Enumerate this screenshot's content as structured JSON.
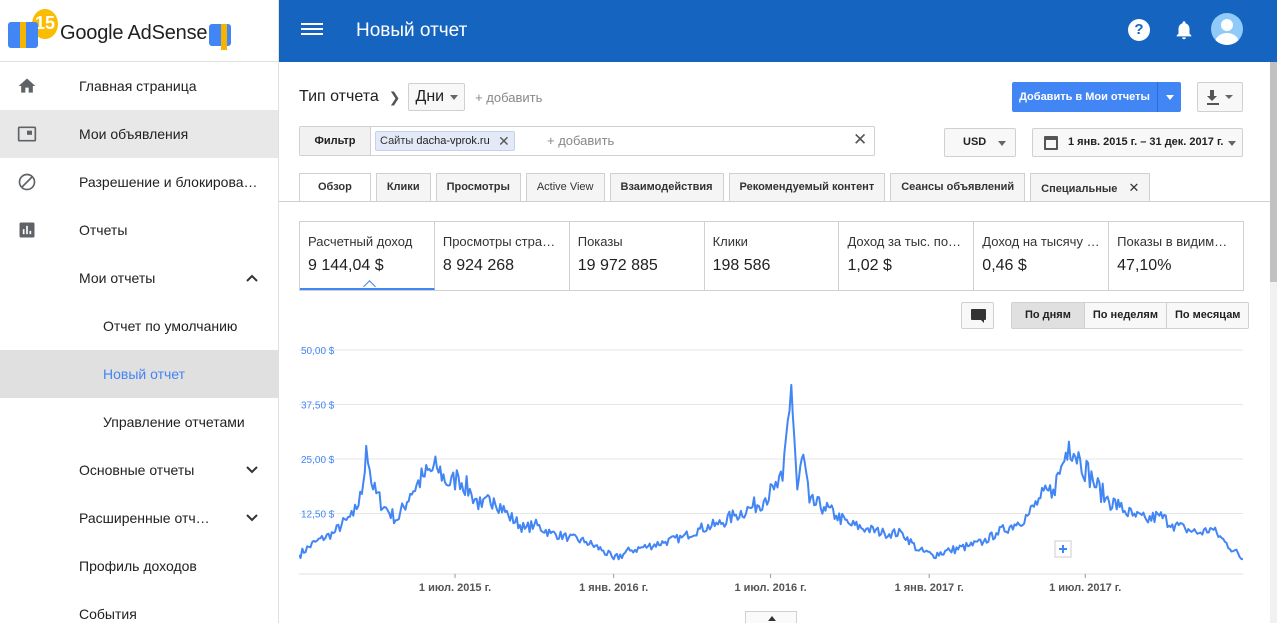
{
  "logo": {
    "badge": "15",
    "brand": "Google AdSense"
  },
  "topbar": {
    "title": "Новый отчет",
    "help": "?"
  },
  "sidebar": {
    "items": [
      {
        "label": "Главная страница",
        "icon": "home-icon"
      },
      {
        "label": "Мои объявления",
        "icon": "ad-unit-icon"
      },
      {
        "label": "Разрешение и блокирова…",
        "icon": "block-icon"
      },
      {
        "label": "Отчеты",
        "icon": "bar-chart-icon"
      },
      {
        "label": "Мои отчеты"
      },
      {
        "label": "Отчет по умолчанию"
      },
      {
        "label": "Новый отчет"
      },
      {
        "label": "Управление отчетами"
      },
      {
        "label": "Основные отчеты"
      },
      {
        "label": "Расширенные отч…"
      },
      {
        "label": "Профиль доходов"
      },
      {
        "label": "События"
      }
    ]
  },
  "report": {
    "type_label": "Тип отчета",
    "dimension": "Дни",
    "add_label": "+ добавить"
  },
  "toolbar": {
    "add_to_reports": "Добавить в Мои отчеты"
  },
  "filter": {
    "label": "Фильтр",
    "chip_prefix": "Сайты",
    "chip_value": "dacha-vprok.ru",
    "add_label": "+ добавить",
    "remove": "✕",
    "clear": "✕"
  },
  "currency": "USD",
  "date_range": "1 янв. 2015 г. – 31 дек. 2017 г.",
  "tabs": [
    "Обзор",
    "Клики",
    "Просмотры",
    "Active View",
    "Взаимодействия",
    "Рекомендуемый контент",
    "Сеансы объявлений",
    "Специальные"
  ],
  "tab_close": "✕",
  "metrics": [
    {
      "label": "Расчетный доход",
      "value": "9 144,04 $"
    },
    {
      "label": "Просмотры стра…",
      "value": "8 924 268"
    },
    {
      "label": "Показы",
      "value": "19 972 885"
    },
    {
      "label": "Клики",
      "value": "198 586"
    },
    {
      "label": "Доход за тыс. по…",
      "value": "1,02 $"
    },
    {
      "label": "Доход на тысячу …",
      "value": "0,46 $"
    },
    {
      "label": "Показы в видим…",
      "value": "47,10%"
    }
  ],
  "period": [
    "По дням",
    "По неделям",
    "По месяцам"
  ],
  "accent": "#4285f4",
  "topbar_color": "#1565c0",
  "chart_data": {
    "type": "line",
    "x_start": "2015-01-01",
    "x_end": "2017-12-31",
    "ylim": [
      0,
      50
    ],
    "y_ticks": [
      "50,00 $",
      "37,50 $",
      "25,00 $",
      "12,50 $"
    ],
    "y_tick_values": [
      50,
      37.5,
      25,
      12.5
    ],
    "x_tick_labels": [
      {
        "date": "2015-07-01",
        "label": "1 июл. 2015 г."
      },
      {
        "date": "2016-01-01",
        "label": "1 янв. 2016 г."
      },
      {
        "date": "2016-07-01",
        "label": "1 июл. 2016 г."
      },
      {
        "date": "2017-01-01",
        "label": "1 янв. 2017 г."
      },
      {
        "date": "2017-07-01",
        "label": "1 июл. 2017 г."
      }
    ],
    "grid": true,
    "series": [
      {
        "color": "#4285f4",
        "points": [
          [
            "2015-01-01",
            3
          ],
          [
            "2015-01-20",
            6
          ],
          [
            "2015-02-10",
            8
          ],
          [
            "2015-02-25",
            11
          ],
          [
            "2015-03-05",
            12
          ],
          [
            "2015-03-15",
            17
          ],
          [
            "2015-03-20",
            28
          ],
          [
            "2015-03-28",
            18
          ],
          [
            "2015-04-10",
            14
          ],
          [
            "2015-04-25",
            11
          ],
          [
            "2015-05-10",
            17
          ],
          [
            "2015-05-25",
            21
          ],
          [
            "2015-06-10",
            23
          ],
          [
            "2015-06-25",
            19
          ],
          [
            "2015-07-05",
            21
          ],
          [
            "2015-07-20",
            17
          ],
          [
            "2015-08-01",
            14
          ],
          [
            "2015-08-15",
            16
          ],
          [
            "2015-09-01",
            12
          ],
          [
            "2015-09-20",
            9
          ],
          [
            "2015-10-01",
            10
          ],
          [
            "2015-10-20",
            8
          ],
          [
            "2015-11-10",
            7
          ],
          [
            "2015-11-30",
            6
          ],
          [
            "2015-12-20",
            4
          ],
          [
            "2016-01-01",
            2
          ],
          [
            "2016-01-20",
            4
          ],
          [
            "2016-02-10",
            5
          ],
          [
            "2016-03-01",
            6
          ],
          [
            "2016-03-20",
            7
          ],
          [
            "2016-04-10",
            9
          ],
          [
            "2016-05-01",
            10
          ],
          [
            "2016-05-20",
            12
          ],
          [
            "2016-06-10",
            14
          ],
          [
            "2016-06-25",
            16
          ],
          [
            "2016-07-05",
            18
          ],
          [
            "2016-07-15",
            20
          ],
          [
            "2016-07-25",
            42
          ],
          [
            "2016-08-01",
            18
          ],
          [
            "2016-08-08",
            26
          ],
          [
            "2016-08-15",
            15
          ],
          [
            "2016-09-01",
            14
          ],
          [
            "2016-09-15",
            12
          ],
          [
            "2016-10-01",
            10
          ],
          [
            "2016-10-20",
            9
          ],
          [
            "2016-11-10",
            8
          ],
          [
            "2016-12-01",
            8
          ],
          [
            "2016-12-20",
            4
          ],
          [
            "2017-01-05",
            3
          ],
          [
            "2017-01-25",
            4
          ],
          [
            "2017-02-15",
            5
          ],
          [
            "2017-03-05",
            6
          ],
          [
            "2017-03-20",
            8
          ],
          [
            "2017-04-10",
            10
          ],
          [
            "2017-04-25",
            12
          ],
          [
            "2017-05-10",
            16
          ],
          [
            "2017-05-25",
            18
          ],
          [
            "2017-06-05",
            24
          ],
          [
            "2017-06-12",
            29
          ],
          [
            "2017-06-25",
            25
          ],
          [
            "2017-07-10",
            20
          ],
          [
            "2017-07-25",
            16
          ],
          [
            "2017-08-10",
            14
          ],
          [
            "2017-08-25",
            12
          ],
          [
            "2017-09-10",
            11
          ],
          [
            "2017-09-25",
            12
          ],
          [
            "2017-10-10",
            10
          ],
          [
            "2017-10-25",
            9
          ],
          [
            "2017-11-10",
            8
          ],
          [
            "2017-11-25",
            9
          ],
          [
            "2017-12-10",
            6
          ],
          [
            "2017-12-31",
            2
          ]
        ]
      }
    ]
  }
}
